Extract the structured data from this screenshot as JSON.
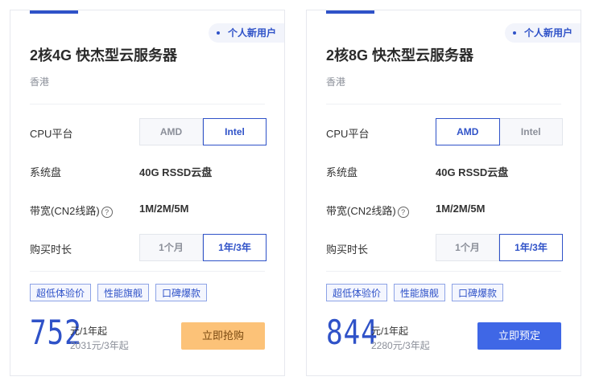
{
  "cards": [
    {
      "badge": "个人新用户",
      "title": "2核4G 快杰型云服务器",
      "region": "香港",
      "cpu_label": "CPU平台",
      "cpu_options": [
        "AMD",
        "Intel"
      ],
      "cpu_selected": "Intel",
      "disk_label": "系统盘",
      "disk_value": "40G RSSD云盘",
      "bandwidth_label": "带宽(CN2线路)",
      "bandwidth_value": "1M/2M/5M",
      "duration_label": "购买时长",
      "duration_options": [
        "1个月",
        "1年/3年"
      ],
      "duration_selected": "1年/3年",
      "tags": [
        "超低体验价",
        "性能旗舰",
        "口碑爆款"
      ],
      "price": "752",
      "price_unit": "元/1年起",
      "price_sub": "2031元/3年起",
      "button": "立即抢购",
      "button_color": "#fcc278"
    },
    {
      "badge": "个人新用户",
      "title": "2核8G 快杰型云服务器",
      "region": "香港",
      "cpu_label": "CPU平台",
      "cpu_options": [
        "AMD",
        "Intel"
      ],
      "cpu_selected": "AMD",
      "disk_label": "系统盘",
      "disk_value": "40G RSSD云盘",
      "bandwidth_label": "带宽(CN2线路)",
      "bandwidth_value": "1M/2M/5M",
      "duration_label": "购买时长",
      "duration_options": [
        "1个月",
        "1年/3年"
      ],
      "duration_selected": "1年/3年",
      "tags": [
        "超低体验价",
        "性能旗舰",
        "口碑爆款"
      ],
      "price": "844",
      "price_unit": "元/1年起",
      "price_sub": "2280元/3年起",
      "button": "立即预定",
      "button_color": "#3f67e6"
    }
  ],
  "colors": {
    "accent": "#2f52c8",
    "muted": "#8b8f99"
  }
}
